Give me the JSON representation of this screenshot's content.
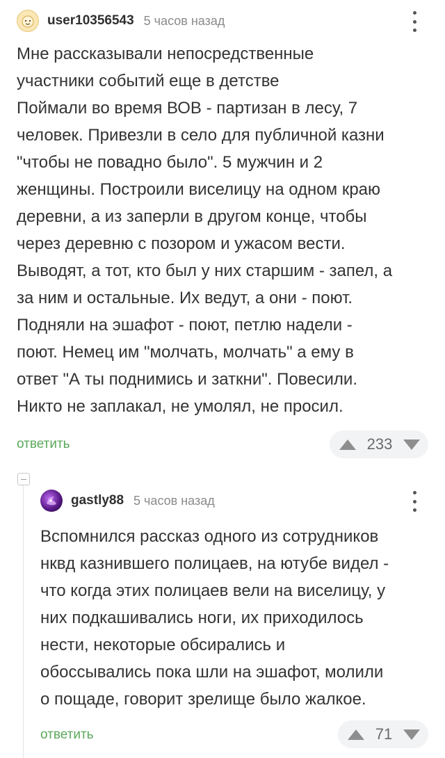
{
  "comments": [
    {
      "username": "user10356543",
      "time": "5 часов назад",
      "text": "Мне рассказывали непосредственные\nучастники событий еще в детстве\nПоймали во время ВОВ - партизан в лесу, 7\nчеловек. Привезли в село для публичной казни\n\"чтобы не повадно было\". 5 мужчин и 2\nженщины. Построили виселицу на одном краю\nдеревни, а из заперли в другом конце, чтобы\nчерез деревню с позором и ужасом вести.\nВыводят, а тот, кто был у них старшим - запел, а\nза ним и остальные. Их ведут, а они - поют.\nПодняли на эшафот - поют, петлю надели -\nпоют. Немец им \"молчать, молчать\" а ему в\nответ \"А ты поднимись и заткни\". Повесили.\nНикто не заплакал, не умолял, не просил.",
      "reply_label": "ответить",
      "rating": "233"
    },
    {
      "username": "gastly88",
      "time": "5 часов назад",
      "text": "Вспомнился рассказ одного из сотрудников\nнквд казнившего полицаев, на ютубе видел -\nчто когда этих полицаев вели на виселицу, у\nних подкашивались ноги, их приходилось\nнести, некоторые обсирались и\nобоссывались пока шли на эшафот, молили\nо пощаде, говорит зрелище было жалкое.",
      "reply_label": "ответить",
      "rating": "71"
    }
  ],
  "colors": {
    "reply": "#5aa85a",
    "rating_bg": "#f2f3f5"
  }
}
